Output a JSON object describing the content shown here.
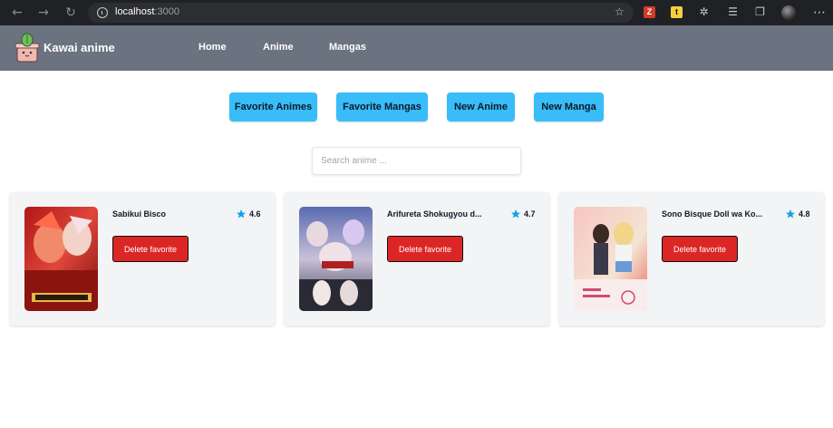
{
  "browser": {
    "url_host": "localhost",
    "url_port": ":3000",
    "icons": [
      "back-arrow-icon",
      "forward-arrow-icon",
      "refresh-icon",
      "info-icon",
      "favorite-star-icon",
      "extensions-icon",
      "favorites-list-icon",
      "collections-icon",
      "profile-avatar",
      "more-menu-icon"
    ]
  },
  "header": {
    "brand": "Kawai anime",
    "nav": [
      {
        "label": "Home"
      },
      {
        "label": "Anime"
      },
      {
        "label": "Mangas"
      }
    ]
  },
  "actions": [
    {
      "label": "Favorite Animes"
    },
    {
      "label": "Favorite Mangas"
    },
    {
      "label": "New Anime"
    },
    {
      "label": "New Manga"
    }
  ],
  "search": {
    "placeholder": "Search anime ...",
    "value": ""
  },
  "cards": [
    {
      "title": "Sabikui Bisco",
      "rating": "4.6",
      "button": "Delete favorite"
    },
    {
      "title": "Arifureta Shokugyou d...",
      "rating": "4.7",
      "button": "Delete favorite"
    },
    {
      "title": "Sono Bisque Doll wa Ko...",
      "rating": "4.8",
      "button": "Delete favorite"
    }
  ],
  "colors": {
    "header_bg": "#6b7280",
    "action_button": "#38bdf8",
    "delete_button": "#dc2626",
    "star": "#0ea5e9",
    "card_bg": "#f3f4f6"
  }
}
